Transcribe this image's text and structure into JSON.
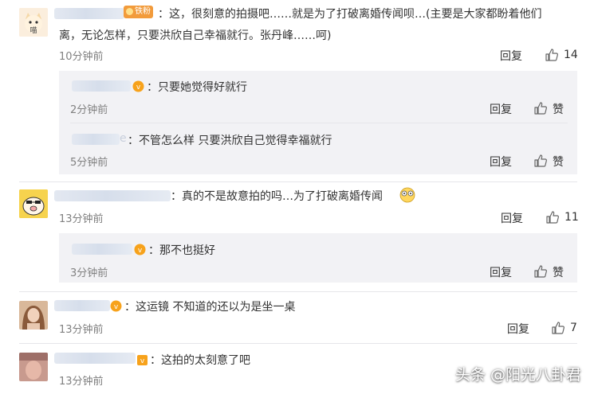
{
  "comments": [
    {
      "badge": "铁粉",
      "text_line1": "：这，很刻意的拍摄吧……就是为了打破离婚传闻呗…(主要是大家都盼着他们",
      "text_line2": "离，无论怎样，只要洪欣自己幸福就行。张丹峰……呵)",
      "time": "10分钟前",
      "reply_label": "回复",
      "like_count": "14",
      "replies": [
        {
          "text": "：只要她觉得好就行",
          "time": "2分钟前",
          "reply_label": "回复",
          "like_label": "赞"
        },
        {
          "name_tail": "e",
          "text": "：不管怎么样 只要洪欣自己觉得幸福就行",
          "time": "5分钟前",
          "reply_label": "回复",
          "like_label": "赞"
        }
      ]
    },
    {
      "text": "：真的不是故意拍的吗…为了打破离婚传闻",
      "time": "13分钟前",
      "reply_label": "回复",
      "like_count": "11",
      "replies": [
        {
          "text": "：那不也挺好",
          "time": "3分钟前",
          "reply_label": "回复",
          "like_label": "赞"
        }
      ]
    },
    {
      "text": "：这运镜 不知道的还以为是坐一桌",
      "time": "13分钟前",
      "reply_label": "回复",
      "like_count": "7"
    },
    {
      "text": "：这拍的太刻意了吧",
      "time": "13分钟前"
    }
  ],
  "watermark": "头条 @阳光八卦君",
  "colors": {
    "vip": "#f7a21b",
    "badge": "#f29b3b",
    "time": "#808080",
    "reply_bg": "#f2f2f5"
  }
}
